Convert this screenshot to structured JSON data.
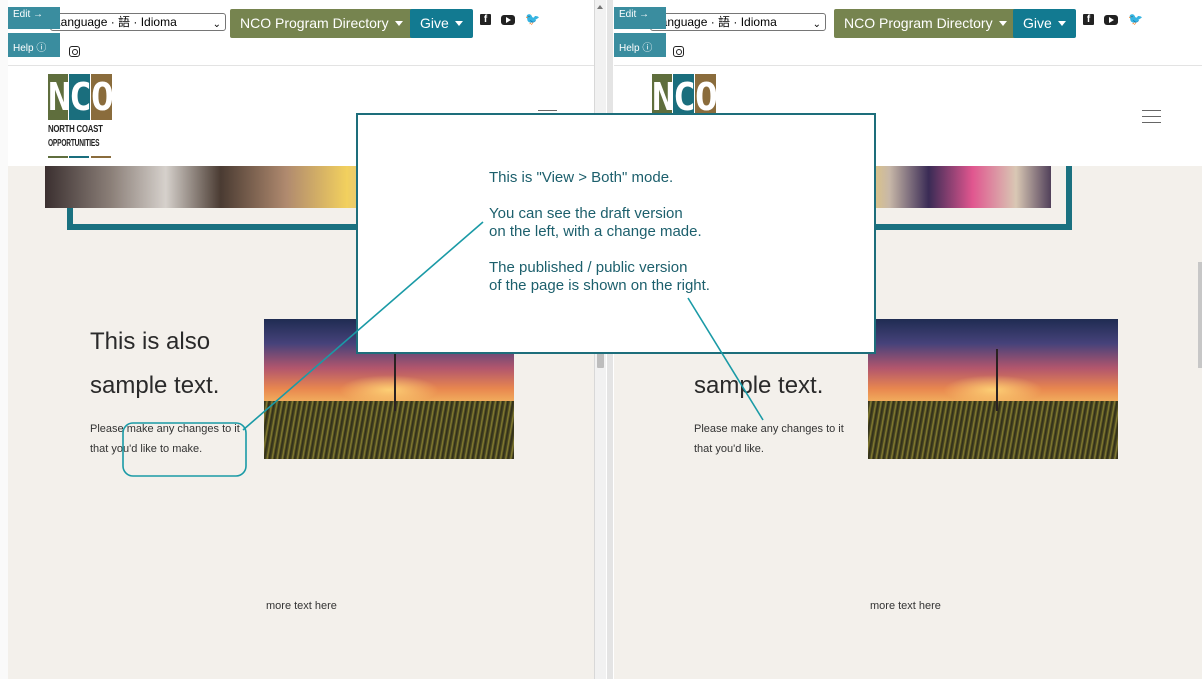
{
  "toolbar": {
    "language_label": "Language · 語 · Idioma",
    "program_directory_label": "NCO Program Directory",
    "give_label": "Give",
    "edit_label": "Edit →",
    "help_label": "Help ⓘ"
  },
  "logo": {
    "letters": [
      "N",
      "C",
      "O"
    ],
    "line1": "NORTH COAST",
    "line2": "OPPORTUNITIES",
    "colors": {
      "n": "#5f6e3d",
      "c": "#1a6e7d",
      "o": "#8a6c3c"
    }
  },
  "draft": {
    "heading_line1": "This is also",
    "heading_line2": "sample text.",
    "body": "Please make any changes to it that you'd like to make.",
    "more_text": "more text here"
  },
  "published": {
    "heading_line2": "sample text.",
    "body": "Please make any changes to it that you'd like.",
    "more_text": "more text here"
  },
  "callout": {
    "line1": "This is \"View > Both\" mode.",
    "line2": "You can see the draft version",
    "line3": "on the left, with a change made.",
    "line4": "The published / public version",
    "line5": "of the page is shown on the right."
  },
  "colors": {
    "accent_green": "#76844f",
    "accent_teal": "#127a91",
    "annotation_teal": "#1a9aa6",
    "page_background": "#f3f0eb"
  }
}
